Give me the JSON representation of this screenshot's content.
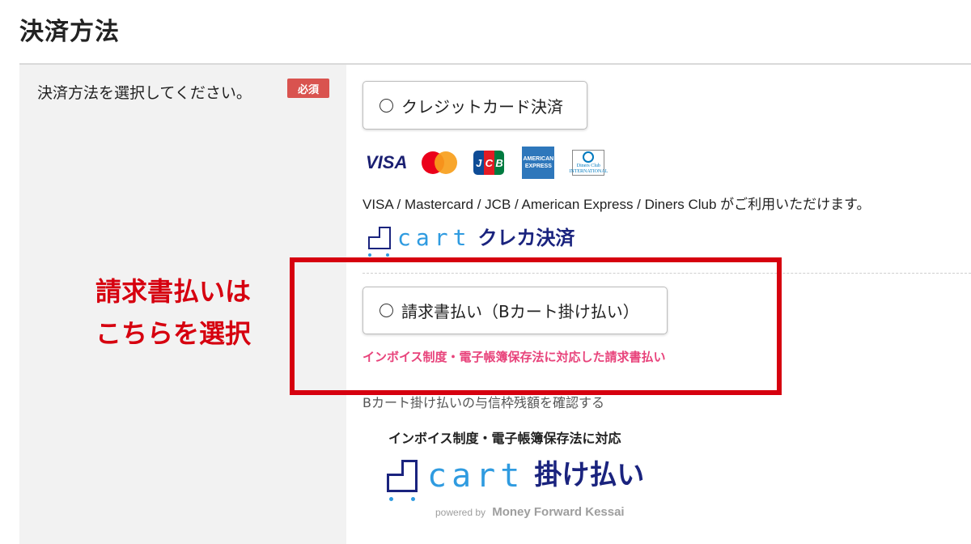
{
  "page": {
    "title": "決済方法"
  },
  "form": {
    "label": "決済方法を選択してください。",
    "required_badge": "必須"
  },
  "options": {
    "credit_card": {
      "label": "クレジットカード決済",
      "brands": [
        "VISA",
        "Mastercard",
        "JCB",
        "American Express",
        "Diners Club"
      ],
      "logo_text": {
        "visa": "VISA",
        "jcb": [
          "J",
          "C",
          "B"
        ],
        "amex": [
          "AMERICAN",
          "EXPRESS"
        ],
        "diners": [
          "Diners Club",
          "INTERNATIONAL"
        ]
      },
      "supported_text": "VISA / Mastercard / JCB / American Express / Diners Club がご利用いただけます。",
      "provider_logo": {
        "word": "cart",
        "suffix": "クレカ決済"
      }
    },
    "invoice": {
      "label": "請求書払い（Bカート掛け払い）",
      "note": "インボイス制度・電子帳簿保存法に対応した請求書払い",
      "limit_link": "Bカート掛け払いの与信枠残額を確認する",
      "compliance_text": "インボイス制度・電子帳簿保存法に対応",
      "provider_logo": {
        "word": "cart",
        "suffix": "掛け払い"
      },
      "powered_by": {
        "prefix": "powered by",
        "company": "Money Forward Kessai"
      }
    }
  },
  "annotation": {
    "callout": "請求書払いはこちらを選択",
    "color": "#d6000f"
  },
  "colors": {
    "required": "#d9534f",
    "invoice_note": "#e8437b",
    "brand_navy": "#1a237e",
    "brand_blue": "#2f9be0"
  }
}
